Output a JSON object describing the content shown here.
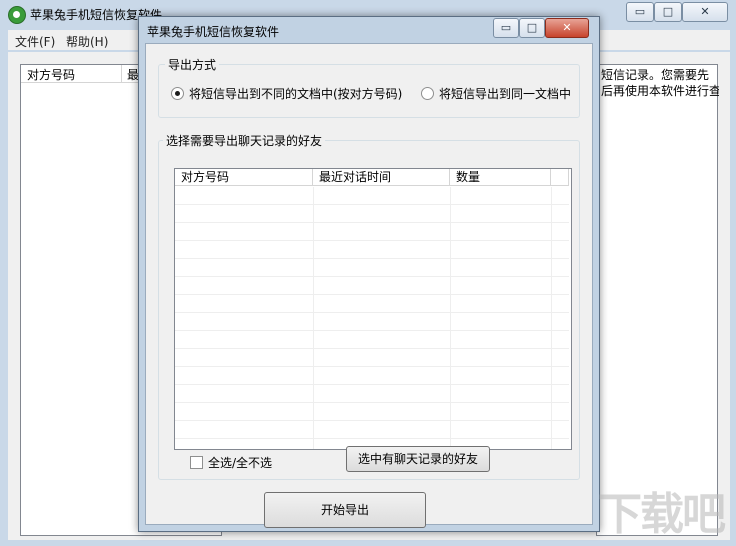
{
  "main_window": {
    "title": "苹果兔手机短信恢复软件",
    "menu": [
      {
        "label": "文件(F)"
      },
      {
        "label": "帮助(H)"
      }
    ],
    "list_columns": [
      {
        "label": "对方号码"
      },
      {
        "label": "最"
      }
    ],
    "right_text": [
      "短信记录。您需要先",
      "后再使用本软件进行查"
    ],
    "controls": {
      "minimize": "▭",
      "maximize": "□",
      "close": "✕"
    }
  },
  "dialog": {
    "title": "苹果兔手机短信恢复软件",
    "controls": {
      "minimize": "▭",
      "maximize": "□",
      "close": "✕"
    },
    "export_mode": {
      "legend": "导出方式",
      "options": [
        {
          "label": "将短信导出到不同的文档中(按对方号码)",
          "selected": true
        },
        {
          "label": "将短信导出到同一文档中",
          "selected": false
        }
      ]
    },
    "friends_group": {
      "legend": "选择需要导出聊天记录的好友",
      "columns": [
        {
          "label": "对方号码"
        },
        {
          "label": "最近对话时间"
        },
        {
          "label": "数量"
        }
      ],
      "select_all_label": "全选/全不选",
      "select_with_records_button": "选中有聊天记录的好友"
    },
    "start_export_button": "开始导出"
  },
  "watermark": "下载吧"
}
